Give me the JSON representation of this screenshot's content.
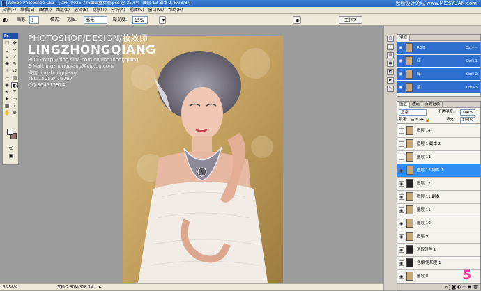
{
  "titlebar": {
    "title": "Adobe Photoshop CS3 - [DPP_0026 726dkd盒女晚.psd @ 35.6% (图层 13 副本 2, RGB/8)]"
  },
  "watermark": "思缘设计论坛 www.MISSYUAN.com",
  "menu": [
    "文件(F)",
    "编辑(E)",
    "图像(I)",
    "图层(L)",
    "选择(S)",
    "滤镜(T)",
    "分析(A)",
    "视图(V)",
    "窗口(W)",
    "帮助(H)"
  ],
  "options": {
    "mode_label": "画笔:",
    "brush_size": "1",
    "blend_label": "模式:",
    "blend_value": "正常",
    "range_label": "范围:",
    "range_value": "高光",
    "exposure_label": "曝光度:",
    "exposure_value": "15%",
    "workspace": "工作区"
  },
  "tools_header": "Ps",
  "overlay": {
    "line1": "PHOTOSHOP/DESIGN/妆效师",
    "line2": "LINGZHONGQIANG",
    "line3": "BLOG:http://blog.sina.com.cn/lingzhongqiang",
    "line4": "E-Mail:lingzhongqiang@vip.qq.com",
    "line5": "微信:lingzhongqiang",
    "line6": "TEL:15052476767",
    "line7": "QQ:364515974"
  },
  "status": {
    "zoom": "35.56%",
    "doc": "文档:7.80M/318.3M"
  },
  "channels": {
    "tabs": [
      "通道"
    ],
    "rows": [
      {
        "name": "RGB",
        "shortcut": "Ctrl+~"
      },
      {
        "name": "红",
        "shortcut": "Ctrl+1"
      },
      {
        "name": "绿",
        "shortcut": "Ctrl+2"
      },
      {
        "name": "蓝",
        "shortcut": "Ctrl+3"
      }
    ]
  },
  "layers_panel": {
    "tabs": [
      "图层",
      "通道",
      "历史记录"
    ],
    "blend_mode": "正常",
    "opacity_label": "不透明度:",
    "opacity": "100%",
    "lock_label": "锁定:",
    "fill_label": "填充:",
    "fill": "100%",
    "layers": [
      {
        "name": "图层 14",
        "visible": false,
        "active": false
      },
      {
        "name": "图层 1 副本 2",
        "visible": false,
        "active": false
      },
      {
        "name": "图层 13",
        "visible": false,
        "active": false
      },
      {
        "name": "图层 13 副本 2",
        "visible": true,
        "active": true
      },
      {
        "name": "图层 12",
        "visible": true,
        "active": false
      },
      {
        "name": "图层 11 副本",
        "visible": true,
        "active": false
      },
      {
        "name": "图层 11",
        "visible": true,
        "active": false
      },
      {
        "name": "图层 10",
        "visible": true,
        "active": false
      },
      {
        "name": "图层 9",
        "visible": true,
        "active": false
      },
      {
        "name": "选取颜色 1",
        "visible": true,
        "active": false
      },
      {
        "name": "色相/饱和度 1",
        "visible": true,
        "active": false
      },
      {
        "name": "图层 8",
        "visible": true,
        "active": false
      }
    ]
  },
  "page_number": "5"
}
